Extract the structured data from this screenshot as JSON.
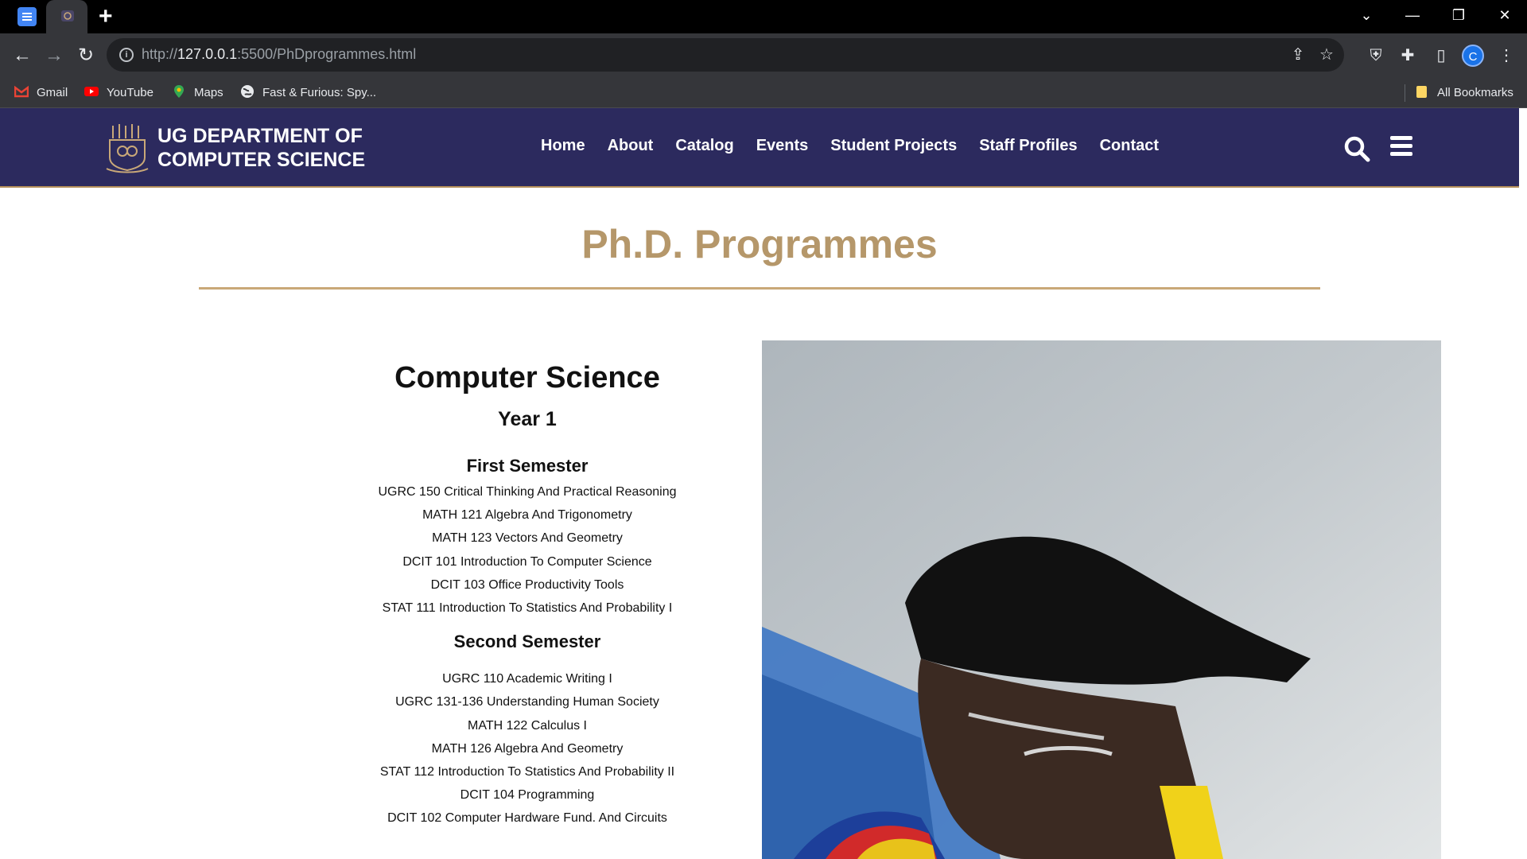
{
  "browser": {
    "url_prefix": "http://",
    "url_host": "127.0.0.1",
    "url_rest": ":5500/PhDprogrammes.html",
    "profile_initial": "C",
    "bookmarks": [
      {
        "label": "Gmail",
        "icon": "gmail-icon"
      },
      {
        "label": "YouTube",
        "icon": "youtube-icon"
      },
      {
        "label": "Maps",
        "icon": "maps-icon"
      },
      {
        "label": "Fast & Furious: Spy...",
        "icon": "globe-icon"
      }
    ],
    "all_bookmarks": "All Bookmarks"
  },
  "site": {
    "brand_line1": "UG DEPARTMENT OF",
    "brand_line2": "COMPUTER SCIENCE",
    "nav": [
      "Home",
      "About",
      "Catalog",
      "Events",
      "Student Projects",
      "Staff Profiles",
      "Contact"
    ],
    "colors": {
      "header_bg": "#2c2a5e",
      "accent_gold": "#b5976a"
    }
  },
  "page": {
    "title": "Ph.D. Programmes",
    "program": "Computer Science",
    "year": "Year 1",
    "first_semester": {
      "title": "First Semester",
      "courses": [
        "UGRC 150 Critical Thinking And Practical Reasoning",
        "MATH 121 Algebra And Trigonometry",
        "MATH 123 Vectors And Geometry",
        "DCIT 101 Introduction To Computer Science",
        "DCIT 103 Office Productivity Tools",
        "STAT 111 Introduction To Statistics And Probability I"
      ]
    },
    "second_semester": {
      "title": "Second Semester",
      "courses": [
        "UGRC 110 Academic Writing I",
        "UGRC 131-136 Understanding Human Society",
        "MATH 122 Calculus I",
        "MATH 126 Algebra And Geometry",
        "STAT 112 Introduction To Statistics And Probability II",
        "DCIT 104 Programming",
        "DCIT 102 Computer Hardware Fund. And Circuits"
      ]
    }
  }
}
